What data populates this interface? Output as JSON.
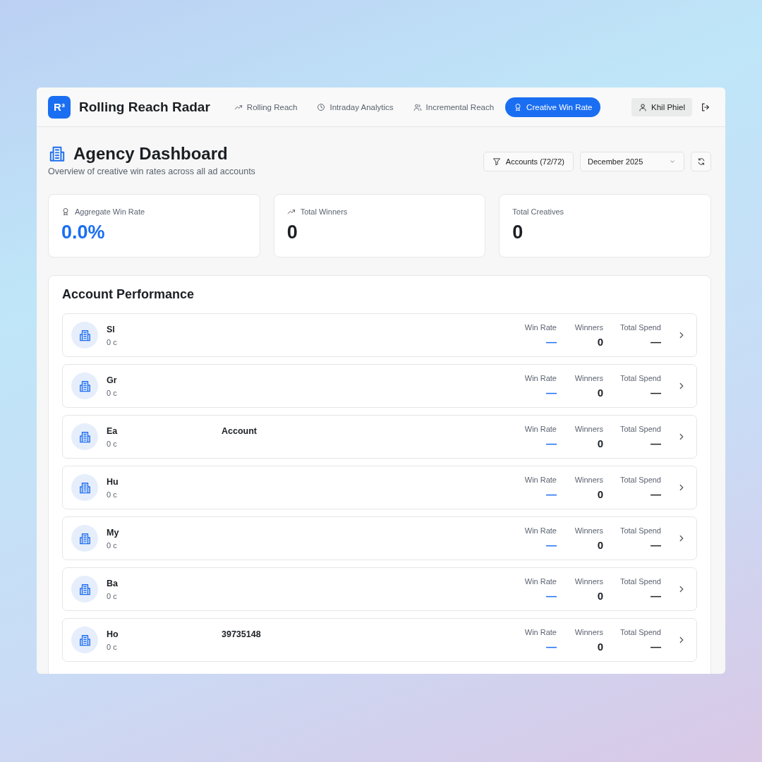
{
  "app": {
    "logo": "R³",
    "title": "Rolling Reach Radar"
  },
  "nav": [
    {
      "label": "Rolling Reach",
      "selected": false
    },
    {
      "label": "Intraday Analytics",
      "selected": false
    },
    {
      "label": "Incremental Reach",
      "selected": false
    },
    {
      "label": "Creative Win Rate",
      "selected": true
    }
  ],
  "user": {
    "name": "Khil Phiel"
  },
  "page": {
    "title": "Agency Dashboard",
    "subtitle": "Overview of creative win rates across all ad accounts"
  },
  "filters": {
    "accounts": "Accounts (72/72)",
    "month": "December 2025"
  },
  "stats": [
    {
      "label": "Aggregate Win Rate",
      "value": "0.0%"
    },
    {
      "label": "Total Winners",
      "value": "0"
    },
    {
      "label": "Total Creatives",
      "value": "0"
    }
  ],
  "performance": {
    "title": "Account Performance",
    "rows": [
      {
        "name": "Sl",
        "name_tail": "",
        "subtitle": "0 c",
        "metrics": [
          {
            "label": "Win Rate",
            "value": "—"
          },
          {
            "label": "Winners",
            "value": "0"
          },
          {
            "label": "Total Spend",
            "value": "—"
          }
        ]
      },
      {
        "name": "Gr",
        "name_tail": "",
        "subtitle": "0 c",
        "metrics": [
          {
            "label": "Win Rate",
            "value": "—"
          },
          {
            "label": "Winners",
            "value": "0"
          },
          {
            "label": "Total Spend",
            "value": "—"
          }
        ]
      },
      {
        "name": "Ea",
        "name_tail": "Account",
        "subtitle": "0 c",
        "metrics": [
          {
            "label": "Win Rate",
            "value": "—"
          },
          {
            "label": "Winners",
            "value": "0"
          },
          {
            "label": "Total Spend",
            "value": "—"
          }
        ]
      },
      {
        "name": "Hu",
        "name_tail": "",
        "subtitle": "0 c",
        "metrics": [
          {
            "label": "Win Rate",
            "value": "—"
          },
          {
            "label": "Winners",
            "value": "0"
          },
          {
            "label": "Total Spend",
            "value": "—"
          }
        ]
      },
      {
        "name": "My",
        "name_tail": "",
        "subtitle": "0 c",
        "metrics": [
          {
            "label": "Win Rate",
            "value": "—"
          },
          {
            "label": "Winners",
            "value": "0"
          },
          {
            "label": "Total Spend",
            "value": "—"
          }
        ]
      },
      {
        "name": "Ba",
        "name_tail": "",
        "subtitle": "0 c",
        "metrics": [
          {
            "label": "Win Rate",
            "value": "—"
          },
          {
            "label": "Winners",
            "value": "0"
          },
          {
            "label": "Total Spend",
            "value": "—"
          }
        ]
      },
      {
        "name": "Ho",
        "name_tail": "39735148",
        "subtitle": "0 c",
        "metrics": [
          {
            "label": "Win Rate",
            "value": "—"
          },
          {
            "label": "Winners",
            "value": "0"
          },
          {
            "label": "Total Spend",
            "value": "—"
          }
        ]
      }
    ]
  }
}
